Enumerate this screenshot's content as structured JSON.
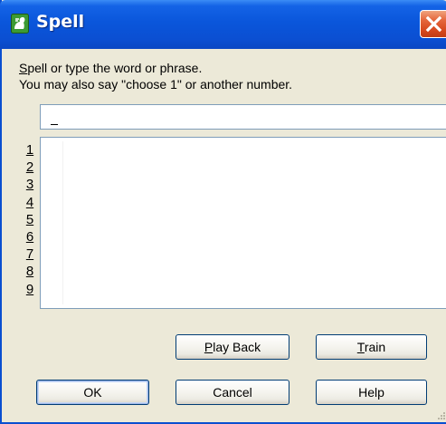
{
  "window": {
    "title": "Spell",
    "colors": {
      "titlebar": "#0a56db",
      "close": "#d6471c",
      "face": "#ece9d8"
    }
  },
  "instructions": {
    "line1_hotkey": "S",
    "line1_rest": "pell or type the word or phrase.",
    "line2": "You may also say \"choose 1\" or another number."
  },
  "input": {
    "value": "",
    "placeholder": ""
  },
  "choices": {
    "numbers": [
      "1",
      "2",
      "3",
      "4",
      "5",
      "6",
      "7",
      "8",
      "9"
    ],
    "items": []
  },
  "buttons": {
    "play_back": {
      "hotkey": "P",
      "rest": "lay Back"
    },
    "train": {
      "hotkey": "T",
      "rest": "rain"
    },
    "ok": "OK",
    "cancel": "Cancel",
    "help": "Help"
  },
  "icons": {
    "app": "speech-app-icon",
    "close": "close-icon",
    "grip": "size-grip-icon"
  }
}
